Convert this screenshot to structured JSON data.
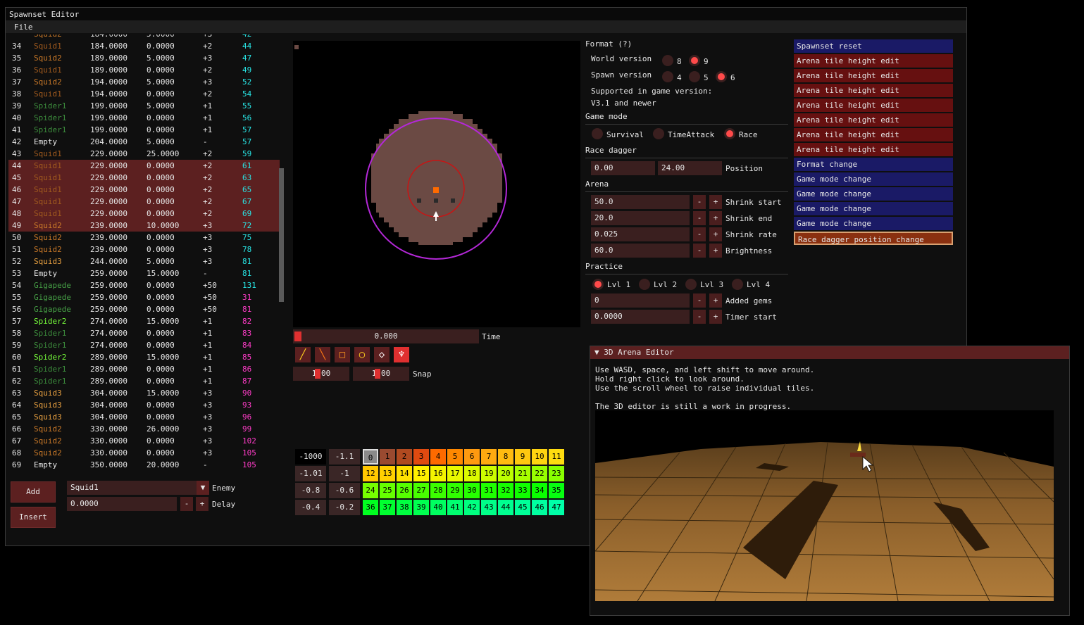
{
  "main_window": {
    "title": "Spawnset Editor",
    "menu": [
      "File"
    ]
  },
  "spawns": {
    "partial_top": {
      "enemy": "Squid2",
      "sec": "184.0000",
      "delay": "5.0000",
      "gems": "+3",
      "total": "42"
    },
    "rows": [
      {
        "idx": "34",
        "enemy": "Squid1",
        "sec": "184.0000",
        "delay": "0.0000",
        "gems": "+2",
        "total": "44",
        "sel": false
      },
      {
        "idx": "35",
        "enemy": "Squid2",
        "sec": "189.0000",
        "delay": "5.0000",
        "gems": "+3",
        "total": "47",
        "sel": false
      },
      {
        "idx": "36",
        "enemy": "Squid1",
        "sec": "189.0000",
        "delay": "0.0000",
        "gems": "+2",
        "total": "49",
        "sel": false
      },
      {
        "idx": "37",
        "enemy": "Squid2",
        "sec": "194.0000",
        "delay": "5.0000",
        "gems": "+3",
        "total": "52",
        "sel": false
      },
      {
        "idx": "38",
        "enemy": "Squid1",
        "sec": "194.0000",
        "delay": "0.0000",
        "gems": "+2",
        "total": "54",
        "sel": false
      },
      {
        "idx": "39",
        "enemy": "Spider1",
        "sec": "199.0000",
        "delay": "5.0000",
        "gems": "+1",
        "total": "55",
        "sel": false
      },
      {
        "idx": "40",
        "enemy": "Spider1",
        "sec": "199.0000",
        "delay": "0.0000",
        "gems": "+1",
        "total": "56",
        "sel": false
      },
      {
        "idx": "41",
        "enemy": "Spider1",
        "sec": "199.0000",
        "delay": "0.0000",
        "gems": "+1",
        "total": "57",
        "sel": false
      },
      {
        "idx": "42",
        "enemy": "Empty",
        "sec": "204.0000",
        "delay": "5.0000",
        "gems": "-",
        "total": "57",
        "sel": false
      },
      {
        "idx": "43",
        "enemy": "Squid1",
        "sec": "229.0000",
        "delay": "25.0000",
        "gems": "+2",
        "total": "59",
        "sel": false
      },
      {
        "idx": "44",
        "enemy": "Squid1",
        "sec": "229.0000",
        "delay": "0.0000",
        "gems": "+2",
        "total": "61",
        "sel": true
      },
      {
        "idx": "45",
        "enemy": "Squid1",
        "sec": "229.0000",
        "delay": "0.0000",
        "gems": "+2",
        "total": "63",
        "sel": true
      },
      {
        "idx": "46",
        "enemy": "Squid1",
        "sec": "229.0000",
        "delay": "0.0000",
        "gems": "+2",
        "total": "65",
        "sel": true
      },
      {
        "idx": "47",
        "enemy": "Squid1",
        "sec": "229.0000",
        "delay": "0.0000",
        "gems": "+2",
        "total": "67",
        "sel": true
      },
      {
        "idx": "48",
        "enemy": "Squid1",
        "sec": "229.0000",
        "delay": "0.0000",
        "gems": "+2",
        "total": "69",
        "sel": true
      },
      {
        "idx": "49",
        "enemy": "Squid2",
        "sec": "239.0000",
        "delay": "10.0000",
        "gems": "+3",
        "total": "72",
        "sel": true
      },
      {
        "idx": "50",
        "enemy": "Squid2",
        "sec": "239.0000",
        "delay": "0.0000",
        "gems": "+3",
        "total": "75",
        "sel": false
      },
      {
        "idx": "51",
        "enemy": "Squid2",
        "sec": "239.0000",
        "delay": "0.0000",
        "gems": "+3",
        "total": "78",
        "sel": false
      },
      {
        "idx": "52",
        "enemy": "Squid3",
        "sec": "244.0000",
        "delay": "5.0000",
        "gems": "+3",
        "total": "81",
        "sel": false
      },
      {
        "idx": "53",
        "enemy": "Empty",
        "sec": "259.0000",
        "delay": "15.0000",
        "gems": "-",
        "total": "81",
        "sel": false
      },
      {
        "idx": "54",
        "enemy": "Gigapede",
        "sec": "259.0000",
        "delay": "0.0000",
        "gems": "+50",
        "total": "131",
        "sel": false
      },
      {
        "idx": "55",
        "enemy": "Gigapede",
        "sec": "259.0000",
        "delay": "0.0000",
        "gems": "+50",
        "total": "31",
        "sel": false
      },
      {
        "idx": "56",
        "enemy": "Gigapede",
        "sec": "259.0000",
        "delay": "0.0000",
        "gems": "+50",
        "total": "81",
        "sel": false
      },
      {
        "idx": "57",
        "enemy": "Spider2",
        "sec": "274.0000",
        "delay": "15.0000",
        "gems": "+1",
        "total": "82",
        "sel": false
      },
      {
        "idx": "58",
        "enemy": "Spider1",
        "sec": "274.0000",
        "delay": "0.0000",
        "gems": "+1",
        "total": "83",
        "sel": false
      },
      {
        "idx": "59",
        "enemy": "Spider1",
        "sec": "274.0000",
        "delay": "0.0000",
        "gems": "+1",
        "total": "84",
        "sel": false
      },
      {
        "idx": "60",
        "enemy": "Spider2",
        "sec": "289.0000",
        "delay": "15.0000",
        "gems": "+1",
        "total": "85",
        "sel": false
      },
      {
        "idx": "61",
        "enemy": "Spider1",
        "sec": "289.0000",
        "delay": "0.0000",
        "gems": "+1",
        "total": "86",
        "sel": false
      },
      {
        "idx": "62",
        "enemy": "Spider1",
        "sec": "289.0000",
        "delay": "0.0000",
        "gems": "+1",
        "total": "87",
        "sel": false
      },
      {
        "idx": "63",
        "enemy": "Squid3",
        "sec": "304.0000",
        "delay": "15.0000",
        "gems": "+3",
        "total": "90",
        "sel": false
      },
      {
        "idx": "64",
        "enemy": "Squid3",
        "sec": "304.0000",
        "delay": "0.0000",
        "gems": "+3",
        "total": "93",
        "sel": false
      },
      {
        "idx": "65",
        "enemy": "Squid3",
        "sec": "304.0000",
        "delay": "0.0000",
        "gems": "+3",
        "total": "96",
        "sel": false
      },
      {
        "idx": "66",
        "enemy": "Squid2",
        "sec": "330.0000",
        "delay": "26.0000",
        "gems": "+3",
        "total": "99",
        "sel": false
      },
      {
        "idx": "67",
        "enemy": "Squid2",
        "sec": "330.0000",
        "delay": "0.0000",
        "gems": "+3",
        "total": "102",
        "sel": false
      },
      {
        "idx": "68",
        "enemy": "Squid2",
        "sec": "330.0000",
        "delay": "0.0000",
        "gems": "+3",
        "total": "105",
        "sel": false
      },
      {
        "idx": "69",
        "enemy": "Empty",
        "sec": "350.0000",
        "delay": "20.0000",
        "gems": "-",
        "total": "105",
        "sel": false
      }
    ]
  },
  "enemy_colors": {
    "Squid1": "#a05a1e",
    "Squid2": "#c87828",
    "Squid3": "#e8a040",
    "Spider1": "#3c8c3c",
    "Spider2": "#78ff3c",
    "Gigapede": "#46a046",
    "Empty": "#e6e6e6"
  },
  "total_colors": {
    "cyan": "#28e6e6",
    "magenta": "#ff3cc8"
  },
  "spawn_controls": {
    "add": "Add",
    "insert": "Insert",
    "enemy_value": "Squid1",
    "enemy_label": "Enemy",
    "delay_value": "0.0000",
    "delay_label": "Delay",
    "minus": "-",
    "plus": "+"
  },
  "arena": {
    "time_value": "0.000",
    "time_label": "Time",
    "snap_a": "1.00",
    "snap_b": "1.00",
    "snap_label": "Snap"
  },
  "palette": {
    "buttons": [
      "-1000",
      "-1.1",
      "-1.01",
      "-1",
      "-0.8",
      "-0.6",
      "-0.4",
      "-0.2"
    ],
    "cells": [
      "0",
      "1",
      "2",
      "3",
      "4",
      "5",
      "6",
      "7",
      "8",
      "9",
      "10",
      "11",
      "12",
      "13",
      "14",
      "15",
      "16",
      "17",
      "18",
      "19",
      "20",
      "21",
      "22",
      "23",
      "24",
      "25",
      "26",
      "27",
      "28",
      "29",
      "30",
      "31",
      "32",
      "33",
      "34",
      "35",
      "36",
      "37",
      "38",
      "39",
      "40",
      "41",
      "42",
      "43",
      "44",
      "45",
      "46",
      "47"
    ]
  },
  "settings": {
    "format": "Format (?)",
    "world_version": "World version",
    "wv_8": "8",
    "wv_9": "9",
    "spawn_version": "Spawn version",
    "sv_4": "4",
    "sv_5": "5",
    "sv_6": "6",
    "supported": "Supported in game version:",
    "supported_ver": "V3.1 and newer",
    "game_mode": "Game mode",
    "gm_survival": "Survival",
    "gm_timeattack": "TimeAttack",
    "gm_race": "Race",
    "race_dagger": "Race dagger",
    "rd_x": "0.00",
    "rd_y": "24.00",
    "rd_label": "Position",
    "arena": "Arena",
    "shrink_start_val": "50.0",
    "shrink_start": "Shrink start",
    "shrink_end_val": "20.0",
    "shrink_end": "Shrink end",
    "shrink_rate_val": "0.025",
    "shrink_rate": "Shrink rate",
    "brightness_val": "60.0",
    "brightness": "Brightness",
    "practice": "Practice",
    "lvl1": "Lvl 1",
    "lvl2": "Lvl 2",
    "lvl3": "Lvl 3",
    "lvl4": "Lvl 4",
    "added_gems_val": "0",
    "added_gems": "Added gems",
    "timer_start_val": "0.0000",
    "timer_start": "Timer start",
    "minus": "-",
    "plus": "+"
  },
  "history": [
    {
      "label": "Spawnset reset",
      "kind": "reset"
    },
    {
      "label": "Arena tile height edit",
      "kind": "tile"
    },
    {
      "label": "Arena tile height edit",
      "kind": "tile"
    },
    {
      "label": "Arena tile height edit",
      "kind": "tile"
    },
    {
      "label": "Arena tile height edit",
      "kind": "tile"
    },
    {
      "label": "Arena tile height edit",
      "kind": "tile"
    },
    {
      "label": "Arena tile height edit",
      "kind": "tile"
    },
    {
      "label": "Arena tile height edit",
      "kind": "tile"
    },
    {
      "label": "Format change",
      "kind": "mode"
    },
    {
      "label": "Game mode change",
      "kind": "mode"
    },
    {
      "label": "Game mode change",
      "kind": "mode"
    },
    {
      "label": "Game mode change",
      "kind": "mode"
    },
    {
      "label": "Game mode change",
      "kind": "mode"
    },
    {
      "label": "Race dagger position change",
      "kind": "cur"
    }
  ],
  "editor3d": {
    "title": "3D Arena Editor",
    "help": "Use WASD, space, and left shift to move around.\nHold right click to look around.\nUse the scroll wheel to raise individual tiles.\n\nThe 3D editor is still a work in progress."
  }
}
